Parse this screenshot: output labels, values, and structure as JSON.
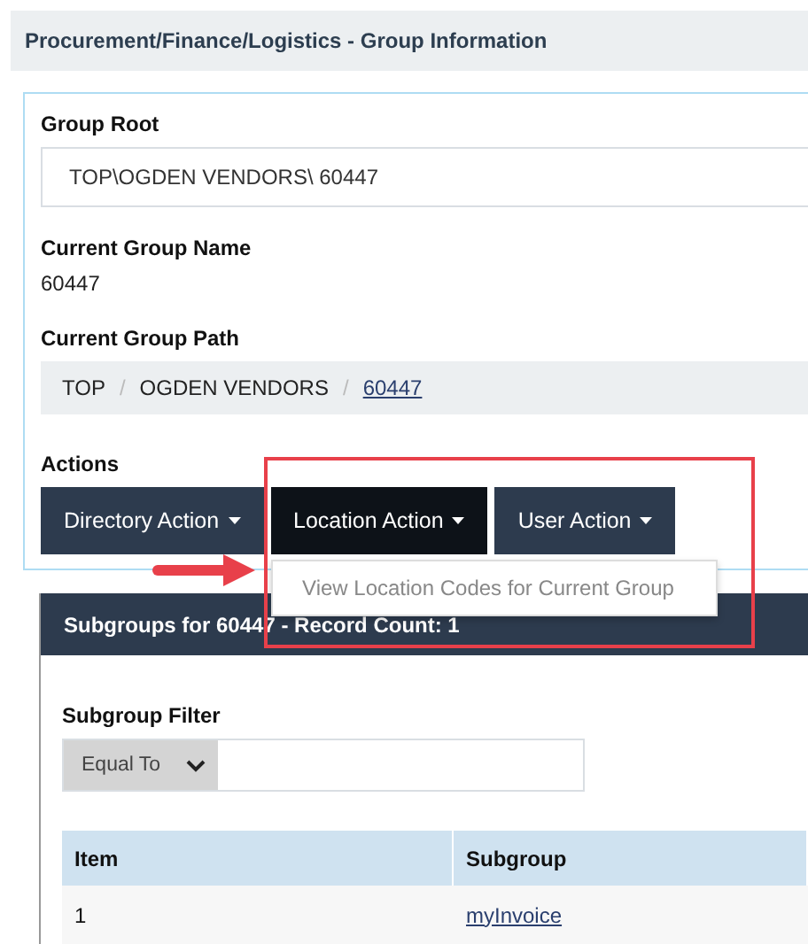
{
  "page_title": "Procurement/Finance/Logistics - Group Information",
  "group_root": {
    "label": "Group Root",
    "value": "TOP\\OGDEN VENDORS\\ 60447"
  },
  "current_group_name": {
    "label": "Current Group Name",
    "value": "60447"
  },
  "current_group_path": {
    "label": "Current Group Path",
    "separator": "/",
    "crumbs": [
      {
        "text": "TOP",
        "link": false
      },
      {
        "text": "OGDEN VENDORS",
        "link": false
      },
      {
        "text": "60447",
        "link": true
      }
    ]
  },
  "actions": {
    "label": "Actions",
    "buttons": [
      {
        "label": "Directory Action",
        "selected": false
      },
      {
        "label": "Location Action",
        "selected": true
      },
      {
        "label": "User Action",
        "selected": false
      }
    ],
    "menu_items": [
      "View Location Codes for Current Group"
    ]
  },
  "subgroups": {
    "title": "Subgroups for 60447 - Record Count: 1",
    "filter_label": "Subgroup Filter",
    "filter_operator": "Equal To",
    "columns": [
      "Item",
      "Subgroup"
    ],
    "rows": [
      [
        "1",
        "myInvoice"
      ]
    ]
  }
}
